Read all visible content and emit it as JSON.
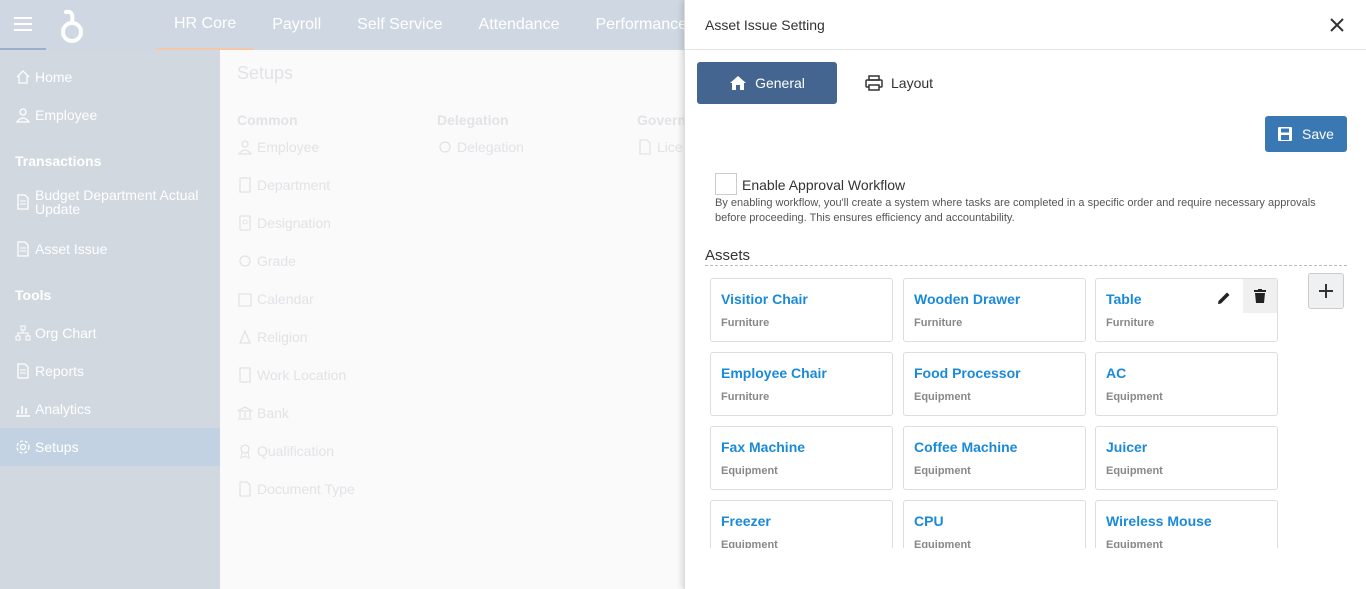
{
  "topnav": {
    "items": [
      "HR Core",
      "Payroll",
      "Self Service",
      "Attendance",
      "Performance"
    ]
  },
  "sidebar": {
    "items": [
      {
        "label": "Home"
      },
      {
        "label": "Employee"
      }
    ],
    "transactions_heading": "Transactions",
    "transactions": [
      {
        "label": "Budget Department Actual Update"
      },
      {
        "label": "Asset Issue"
      }
    ],
    "tools_heading": "Tools",
    "tools": [
      {
        "label": "Org Chart"
      },
      {
        "label": "Reports"
      },
      {
        "label": "Analytics"
      },
      {
        "label": "Setups"
      }
    ]
  },
  "setups": {
    "title": "Setups",
    "common_heading": "Common",
    "common": [
      "Employee",
      "Department",
      "Designation",
      "Grade",
      "Calendar",
      "Religion",
      "Work Location",
      "Bank",
      "Qualification",
      "Document Type"
    ],
    "delegation_heading": "Delegation",
    "delegation": [
      "Delegation"
    ],
    "governance_heading": "Govern",
    "governance": [
      "Lice"
    ]
  },
  "panel": {
    "title": "Asset Issue Setting",
    "tab_general": "General",
    "tab_layout": "Layout",
    "save_label": "Save",
    "workflow_label": "Enable Approval Workflow",
    "workflow_checked": false,
    "workflow_desc": "By enabling workflow, you'll create a system where tasks are completed in a specific order and require necessary approvals before proceeding. This ensures efficiency and accountability.",
    "assets_title": "Assets",
    "assets": [
      {
        "name": "Visitior Chair",
        "category": "Furniture"
      },
      {
        "name": "Wooden Drawer",
        "category": "Furniture"
      },
      {
        "name": "Table",
        "category": "Furniture"
      },
      {
        "name": "Employee Chair",
        "category": "Furniture"
      },
      {
        "name": "Food Processor",
        "category": "Equipment"
      },
      {
        "name": "AC",
        "category": "Equipment"
      },
      {
        "name": "Fax Machine",
        "category": "Equipment"
      },
      {
        "name": "Coffee Machine",
        "category": "Equipment"
      },
      {
        "name": "Juicer",
        "category": "Equipment"
      },
      {
        "name": "Freezer",
        "category": "Equipment"
      },
      {
        "name": "CPU",
        "category": "Equipment"
      },
      {
        "name": "Wireless Mouse",
        "category": "Equipment"
      }
    ]
  },
  "colors": {
    "accent": "#44658f",
    "save": "#3a78b4",
    "link": "#1a8ad8"
  }
}
